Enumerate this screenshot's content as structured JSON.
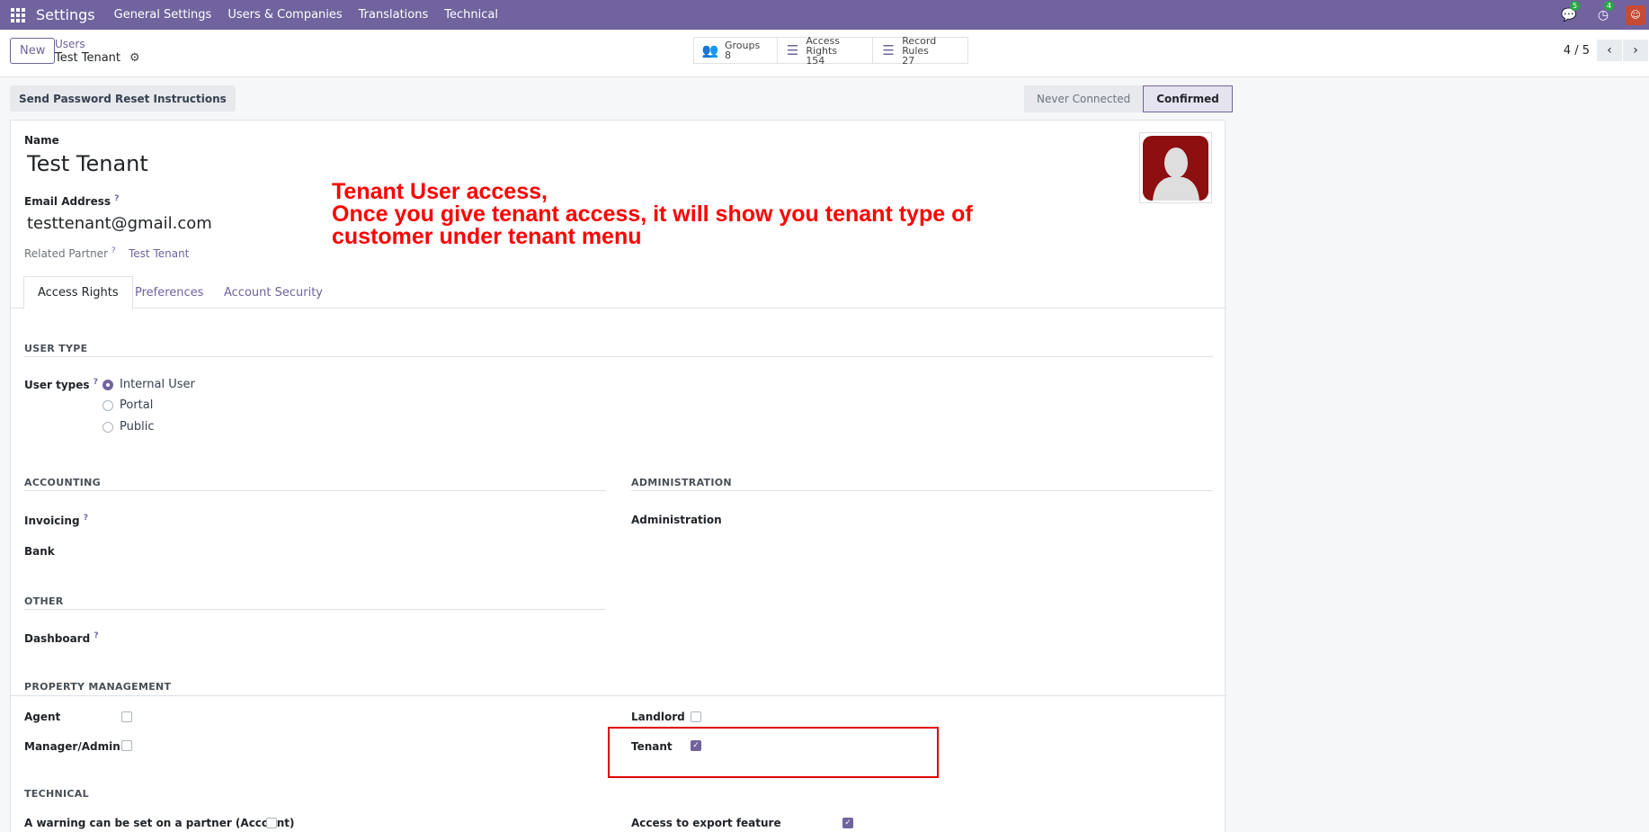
{
  "navbar": {
    "app": "Settings",
    "menus": [
      "General Settings",
      "Users & Companies",
      "Translations",
      "Technical"
    ],
    "messages_count": "5",
    "activities_count": "4"
  },
  "control": {
    "new_label": "New",
    "breadcrumb_parent": "Users",
    "breadcrumb_current": "Test Tenant",
    "smart_buttons": [
      {
        "label": "Groups",
        "value": "8",
        "icon": "users-icon"
      },
      {
        "label": "Access Rights",
        "value": "154",
        "icon": "list-icon"
      },
      {
        "label": "Record Rules",
        "value": "27",
        "icon": "list-icon"
      }
    ],
    "pager": "4 / 5"
  },
  "status": {
    "reset_label": "Send Password Reset Instructions",
    "stages": [
      "Never Connected",
      "Confirmed"
    ],
    "active_stage": "Confirmed"
  },
  "form": {
    "name_label": "Name",
    "name_value": "Test Tenant",
    "email_label": "Email Address",
    "email_value": "testtenant@gmail.com",
    "partner_label": "Related Partner",
    "partner_value": "Test Tenant",
    "tabs": [
      "Access Rights",
      "Preferences",
      "Account Security"
    ],
    "user_type_section": "USER TYPE",
    "user_types_label": "User types",
    "user_types": [
      "Internal User",
      "Portal",
      "Public"
    ],
    "selected_user_type": "Internal User",
    "accounting_section": "ACCOUNTING",
    "invoicing_label": "Invoicing",
    "bank_label": "Bank",
    "administration_section": "ADMINISTRATION",
    "administration_label": "Administration",
    "other_section": "OTHER",
    "dashboard_label": "Dashboard",
    "property_section": "PROPERTY MANAGEMENT",
    "agent_label": "Agent",
    "manager_label": "Manager/Admin",
    "landlord_label": "Landlord",
    "tenant_label": "Tenant",
    "agent_checked": false,
    "manager_checked": false,
    "landlord_checked": false,
    "tenant_checked": true,
    "technical_section": "TECHNICAL",
    "warning_label": "A warning can be set on a partner (Account)",
    "export_label": "Access to export feature",
    "warning_checked": false,
    "export_checked": true
  },
  "annotation": {
    "line1": "Tenant User access,",
    "line2": "Once you give tenant access, it will show you tenant type of",
    "line3": "customer under tenant menu",
    "color": "#ff0000"
  },
  "colors": {
    "brand": "#71639e"
  }
}
